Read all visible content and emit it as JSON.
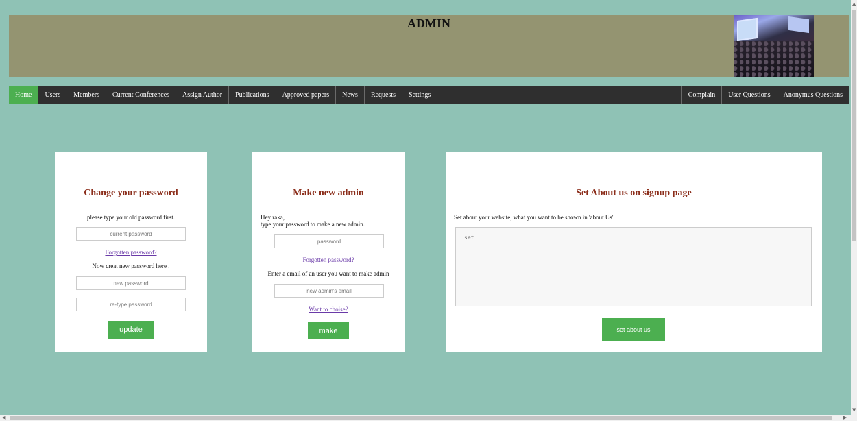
{
  "header": {
    "title": "ADMIN"
  },
  "nav": {
    "left": [
      "Home",
      "Users",
      "Members",
      "Current Conferences",
      "Assign Author",
      "Publications",
      "Approved papers",
      "News",
      "Requests",
      "Settings"
    ],
    "right": [
      "Complain",
      "User Questions",
      "Anonymus Questions"
    ],
    "active": "Home"
  },
  "password_card": {
    "title": "Change your password",
    "instruction": "please type your old password first.",
    "current_placeholder": "current password",
    "forgot_link": "Forgotten password?",
    "new_instruction": "Now creat new password here .",
    "new_placeholder": "new password",
    "retype_placeholder": "re-type password",
    "button": "update"
  },
  "admin_card": {
    "title": "Make new admin",
    "greeting": "Hey raka,",
    "instruction": "type your password to make a new admin.",
    "password_placeholder": "password",
    "forgot_link": "Forgotten password?",
    "email_instruction": "Enter a email of an user you want to make admin",
    "email_placeholder": "new admin's email",
    "choose_link": "Want to choise?",
    "button": "make"
  },
  "about_card": {
    "title": "Set About us on signup page",
    "instruction": "Set about your website, what you want to be shown in 'about Us'.",
    "textarea_value": "set",
    "button": "set about us"
  },
  "colors": {
    "accent": "#4caf50",
    "page_bg": "#8fc2b5",
    "header_bg": "#949471",
    "nav_bg": "#2f2f2f",
    "title_color": "#8b2d1a"
  }
}
